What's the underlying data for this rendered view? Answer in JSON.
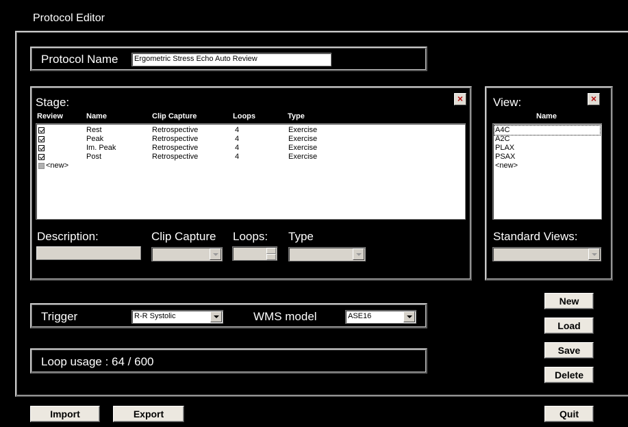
{
  "window": {
    "title": "Protocol Editor"
  },
  "protocol": {
    "label": "Protocol Name",
    "value": "Ergometric Stress Echo Auto Review"
  },
  "stage": {
    "label": "Stage:",
    "close_glyph": "×",
    "headers": {
      "review": "Review",
      "name": "Name",
      "clip_capture": "Clip Capture",
      "loops": "Loops",
      "type": "Type"
    },
    "rows": [
      {
        "review": true,
        "name": "Rest",
        "clip_capture": "Retrospective",
        "loops": "4",
        "type": "Exercise"
      },
      {
        "review": true,
        "name": "Peak",
        "clip_capture": "Retrospective",
        "loops": "4",
        "type": "Exercise"
      },
      {
        "review": true,
        "name": "Im. Peak",
        "clip_capture": "Retrospective",
        "loops": "4",
        "type": "Exercise"
      },
      {
        "review": true,
        "name": "Post",
        "clip_capture": "Retrospective",
        "loops": "4",
        "type": "Exercise"
      }
    ],
    "new_item": "<new>",
    "fields": {
      "description_label": "Description:",
      "clip_capture_label": "Clip Capture",
      "loops_label": "Loops:",
      "type_label": "Type"
    }
  },
  "view": {
    "label": "View:",
    "close_glyph": "×",
    "header_name": "Name",
    "items": [
      "A4C",
      "A2C",
      "PLAX",
      "PSAX",
      "<new>"
    ],
    "standard_views_label": "Standard Views:"
  },
  "trigger": {
    "label": "Trigger",
    "value": "R-R Systolic"
  },
  "wms": {
    "label": "WMS model",
    "value": "ASE16"
  },
  "loop_usage": {
    "text": "Loop usage : 64 / 600"
  },
  "buttons": {
    "new": "New",
    "load": "Load",
    "save": "Save",
    "delete": "Delete",
    "import": "Import",
    "export": "Export",
    "quit": "Quit"
  },
  "colors": {
    "background": "#000000",
    "frame": "#c8c8c8",
    "close_x": "#b41414",
    "button": "#ece8e0"
  }
}
